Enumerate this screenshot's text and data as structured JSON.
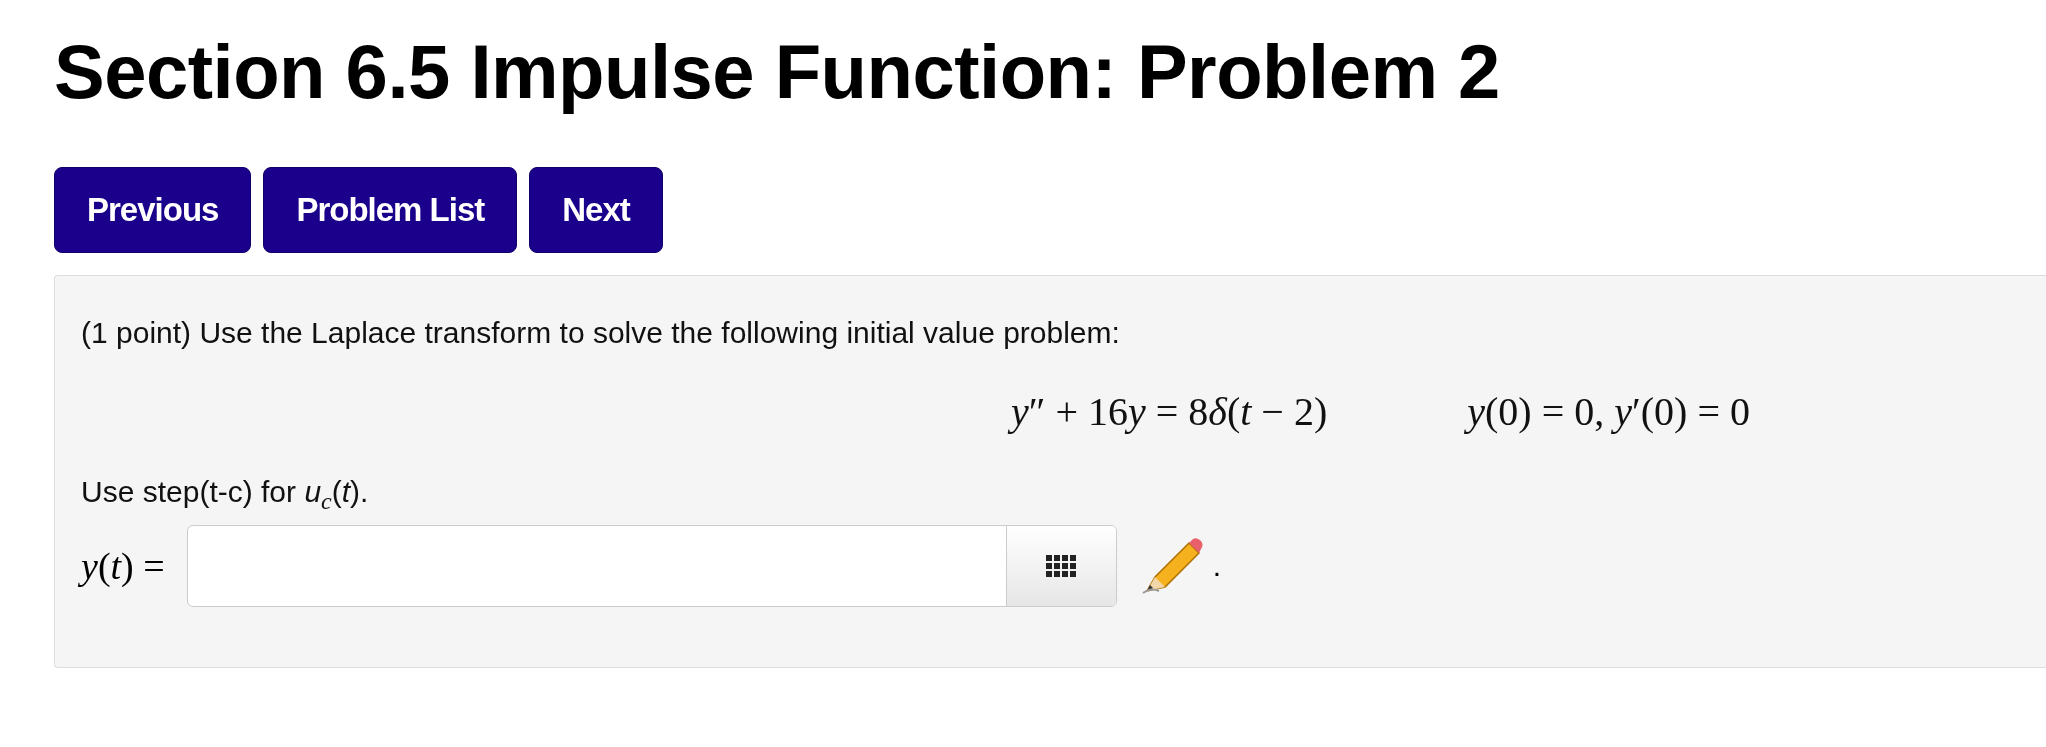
{
  "title": "Section 6.5 Impulse Function: Problem 2",
  "nav_buttons": [
    "Previous",
    "Problem List",
    "Next"
  ],
  "problem": {
    "intro": "(1 point) Use the Laplace transform to solve the following initial value problem:",
    "equation": [
      {
        "text": "y",
        "italic": true
      },
      {
        "text": "″ + 16",
        "italic": false
      },
      {
        "text": "y",
        "italic": true
      },
      {
        "text": " = 8",
        "italic": false
      },
      {
        "text": "δ",
        "italic": true
      },
      {
        "text": "(",
        "italic": false
      },
      {
        "text": "t",
        "italic": true
      },
      {
        "text": " − 2)",
        "italic": false
      }
    ],
    "conditions": "*y*(0) = 0,  *y*′(0) = 0",
    "hint": "Use step(t-c) for *u*$_{c}$(*t*).",
    "answer_label": "*y*(*t*) =",
    "trailing": "."
  }
}
